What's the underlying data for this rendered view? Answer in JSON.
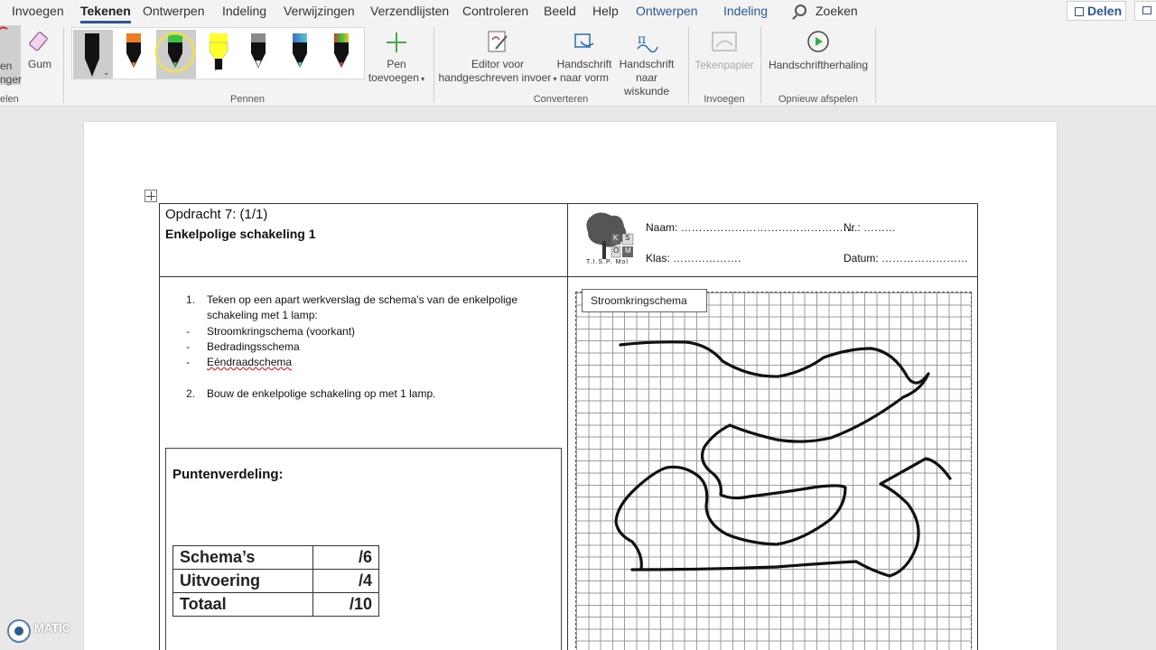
{
  "ribbon": {
    "tabs": [
      {
        "label": "Invoegen"
      },
      {
        "label": "Tekenen"
      },
      {
        "label": "Ontwerpen"
      },
      {
        "label": "Indeling"
      },
      {
        "label": "Verwijzingen"
      },
      {
        "label": "Verzendlijsten"
      },
      {
        "label": "Controleren"
      },
      {
        "label": "Beeld"
      },
      {
        "label": "Help"
      },
      {
        "label": "Ontwerpen"
      },
      {
        "label": "Indeling"
      }
    ],
    "active_tab": "Tekenen",
    "search_label": "Zoeken",
    "share_label": "Delen",
    "tools": {
      "lasso_label_partial": "en",
      "lasso_label_line2": "nger",
      "eraser_label": "Gum",
      "group_label_left": "elen"
    },
    "pens_group_label": "Pennen",
    "pens": [
      {
        "name": "black-pen",
        "color": "#111111"
      },
      {
        "name": "orange-pen",
        "color": "#f07a1f"
      },
      {
        "name": "green-pen",
        "color": "#3ec13e"
      },
      {
        "name": "yellow-highlighter",
        "color": "#ffff2a"
      },
      {
        "name": "pencil",
        "color": "#8a8a8a"
      },
      {
        "name": "galaxy-pen",
        "color": "#3f6fc0"
      },
      {
        "name": "rainbow-pen",
        "color": "#d23c2c"
      }
    ],
    "add_pen": {
      "line1": "Pen",
      "line2": "toevoegen"
    },
    "convert": {
      "editor": {
        "line1": "Editor voor",
        "line2": "handgeschreven invoer"
      },
      "shape": {
        "line1": "Handschrift",
        "line2": "naar vorm"
      },
      "math": {
        "line1": "Handschrift",
        "line2": "naar wiskunde"
      },
      "group_label": "Converteren"
    },
    "insert": {
      "label": "Tekenpapier",
      "group_label": "Invoegen"
    },
    "replay": {
      "label": "Handschriftherhaling",
      "group_label": "Opnieuw afspelen"
    }
  },
  "document": {
    "assignment_line": "Opdracht 7: (1/1)",
    "assignment_title": "Enkelpolige schakeling 1",
    "logo_caption": "T.I.S.P. Mol",
    "logo_letters": [
      "K",
      "S",
      "O",
      "M"
    ],
    "fields": {
      "naam": "Naam: …………………………………………",
      "nr": "Nr.: ………",
      "klas": "Klas: ……………….",
      "datum": "Datum: ……………………"
    },
    "task1_num": "1.",
    "task1_line1": "Teken op een apart werkverslag de schema’s van de enkelpolige",
    "task1_line2": "schakeling met 1 lamp:",
    "subitems": [
      "Stroomkringschema (voorkant)",
      "Bedradingsschema",
      "Eéndraadschema"
    ],
    "dash": "-",
    "task2_num": "2.",
    "task2_text": "Bouw de enkelpolige schakeling op met 1 lamp.",
    "grid_label": "Stroomkringschema",
    "points_title": "Puntenverdeling:",
    "scores": [
      {
        "label": "Schema’s",
        "value": "/6"
      },
      {
        "label": "Uitvoering",
        "value": "/4"
      },
      {
        "label": "Totaal",
        "value": "/10"
      }
    ]
  },
  "watermark": "MATIC"
}
